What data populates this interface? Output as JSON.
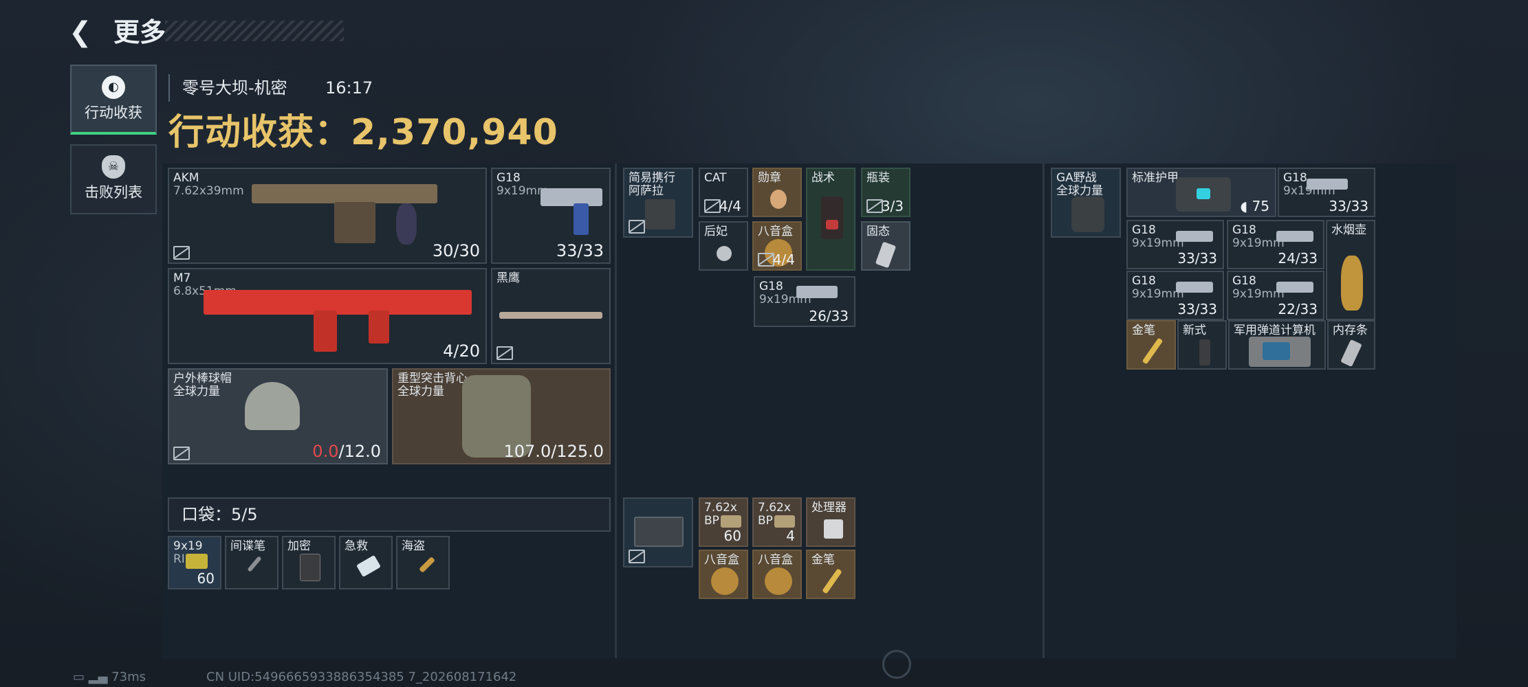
{
  "header": {
    "back_icon": "back-arrow-icon",
    "title": "更多"
  },
  "nav": {
    "items": [
      {
        "label": "行动收获",
        "icon": "loot-icon",
        "active": true
      },
      {
        "label": "击败列表",
        "icon": "skull-icon",
        "active": false
      }
    ]
  },
  "raid": {
    "map": "零号大坝-机密",
    "time": "16:17",
    "loot_label": "行动收获：",
    "loot_value": "2,370,940"
  },
  "equipment": {
    "akm": {
      "name": "AKM",
      "caliber": "7.62x39mm",
      "ammo": "30/30"
    },
    "g18a": {
      "name": "G18",
      "caliber": "9x19mm",
      "ammo": "33/33"
    },
    "m7": {
      "name": "M7",
      "caliber": "6.8x51mm",
      "ammo": "4/20"
    },
    "knife": {
      "name": "黑鹰"
    },
    "helmet": {
      "name": "户外棒球帽",
      "sub": "全球力量",
      "dur_current": "0.0",
      "dur_max": "/12.0"
    },
    "vest": {
      "name": "重型突击背心",
      "sub": "全球力量",
      "dur": "107.0/125.0"
    }
  },
  "pocket": {
    "label": "口袋：",
    "count": "5/5",
    "items": [
      {
        "name": "9x19",
        "sub": "RIP",
        "count": "60"
      },
      {
        "name": "间谍笔"
      },
      {
        "name": "加密"
      },
      {
        "name": "急救"
      },
      {
        "name": "海盗"
      }
    ]
  },
  "rig": {
    "name": "简易携行",
    "sub": "阿萨拉",
    "items": [
      {
        "name": "CAT",
        "count": "4/4"
      },
      {
        "name": "勋章"
      },
      {
        "name": "战术"
      },
      {
        "name": "瓶装",
        "count": "3/3"
      },
      {
        "name": "后妃"
      },
      {
        "name": "八音盒",
        "count": "4/4"
      },
      {
        "name": "固态"
      },
      {
        "name": "G18",
        "caliber": "9x19mm",
        "count": "26/33"
      }
    ]
  },
  "case": {
    "items": [
      {
        "name": "7.62x",
        "sub": "BP",
        "count": "60"
      },
      {
        "name": "7.62x",
        "sub": "BP",
        "count": "4"
      },
      {
        "name": "处理器"
      },
      {
        "name": "八音盒"
      },
      {
        "name": "八音盒"
      },
      {
        "name": "金笔"
      }
    ]
  },
  "backpack": {
    "name": "GA野战",
    "sub": "全球力量",
    "items": [
      {
        "name": "标准护甲",
        "count": "75"
      },
      {
        "name": "G18",
        "caliber": "9x19mm",
        "count": "33/33"
      },
      {
        "name": "G18",
        "caliber": "9x19mm",
        "count": "33/33"
      },
      {
        "name": "G18",
        "caliber": "9x19mm",
        "count": "24/33"
      },
      {
        "name": "水烟壶"
      },
      {
        "name": "G18",
        "caliber": "9x19mm",
        "count": "33/33"
      },
      {
        "name": "G18",
        "caliber": "9x19mm",
        "count": "22/33"
      },
      {
        "name": "金笔"
      },
      {
        "name": "新式"
      },
      {
        "name": "军用弹道计算机"
      },
      {
        "name": "内存条"
      }
    ]
  },
  "footer": {
    "ping": "73ms",
    "uid": "CN UID:5496665933886354385 7_202608171642"
  }
}
